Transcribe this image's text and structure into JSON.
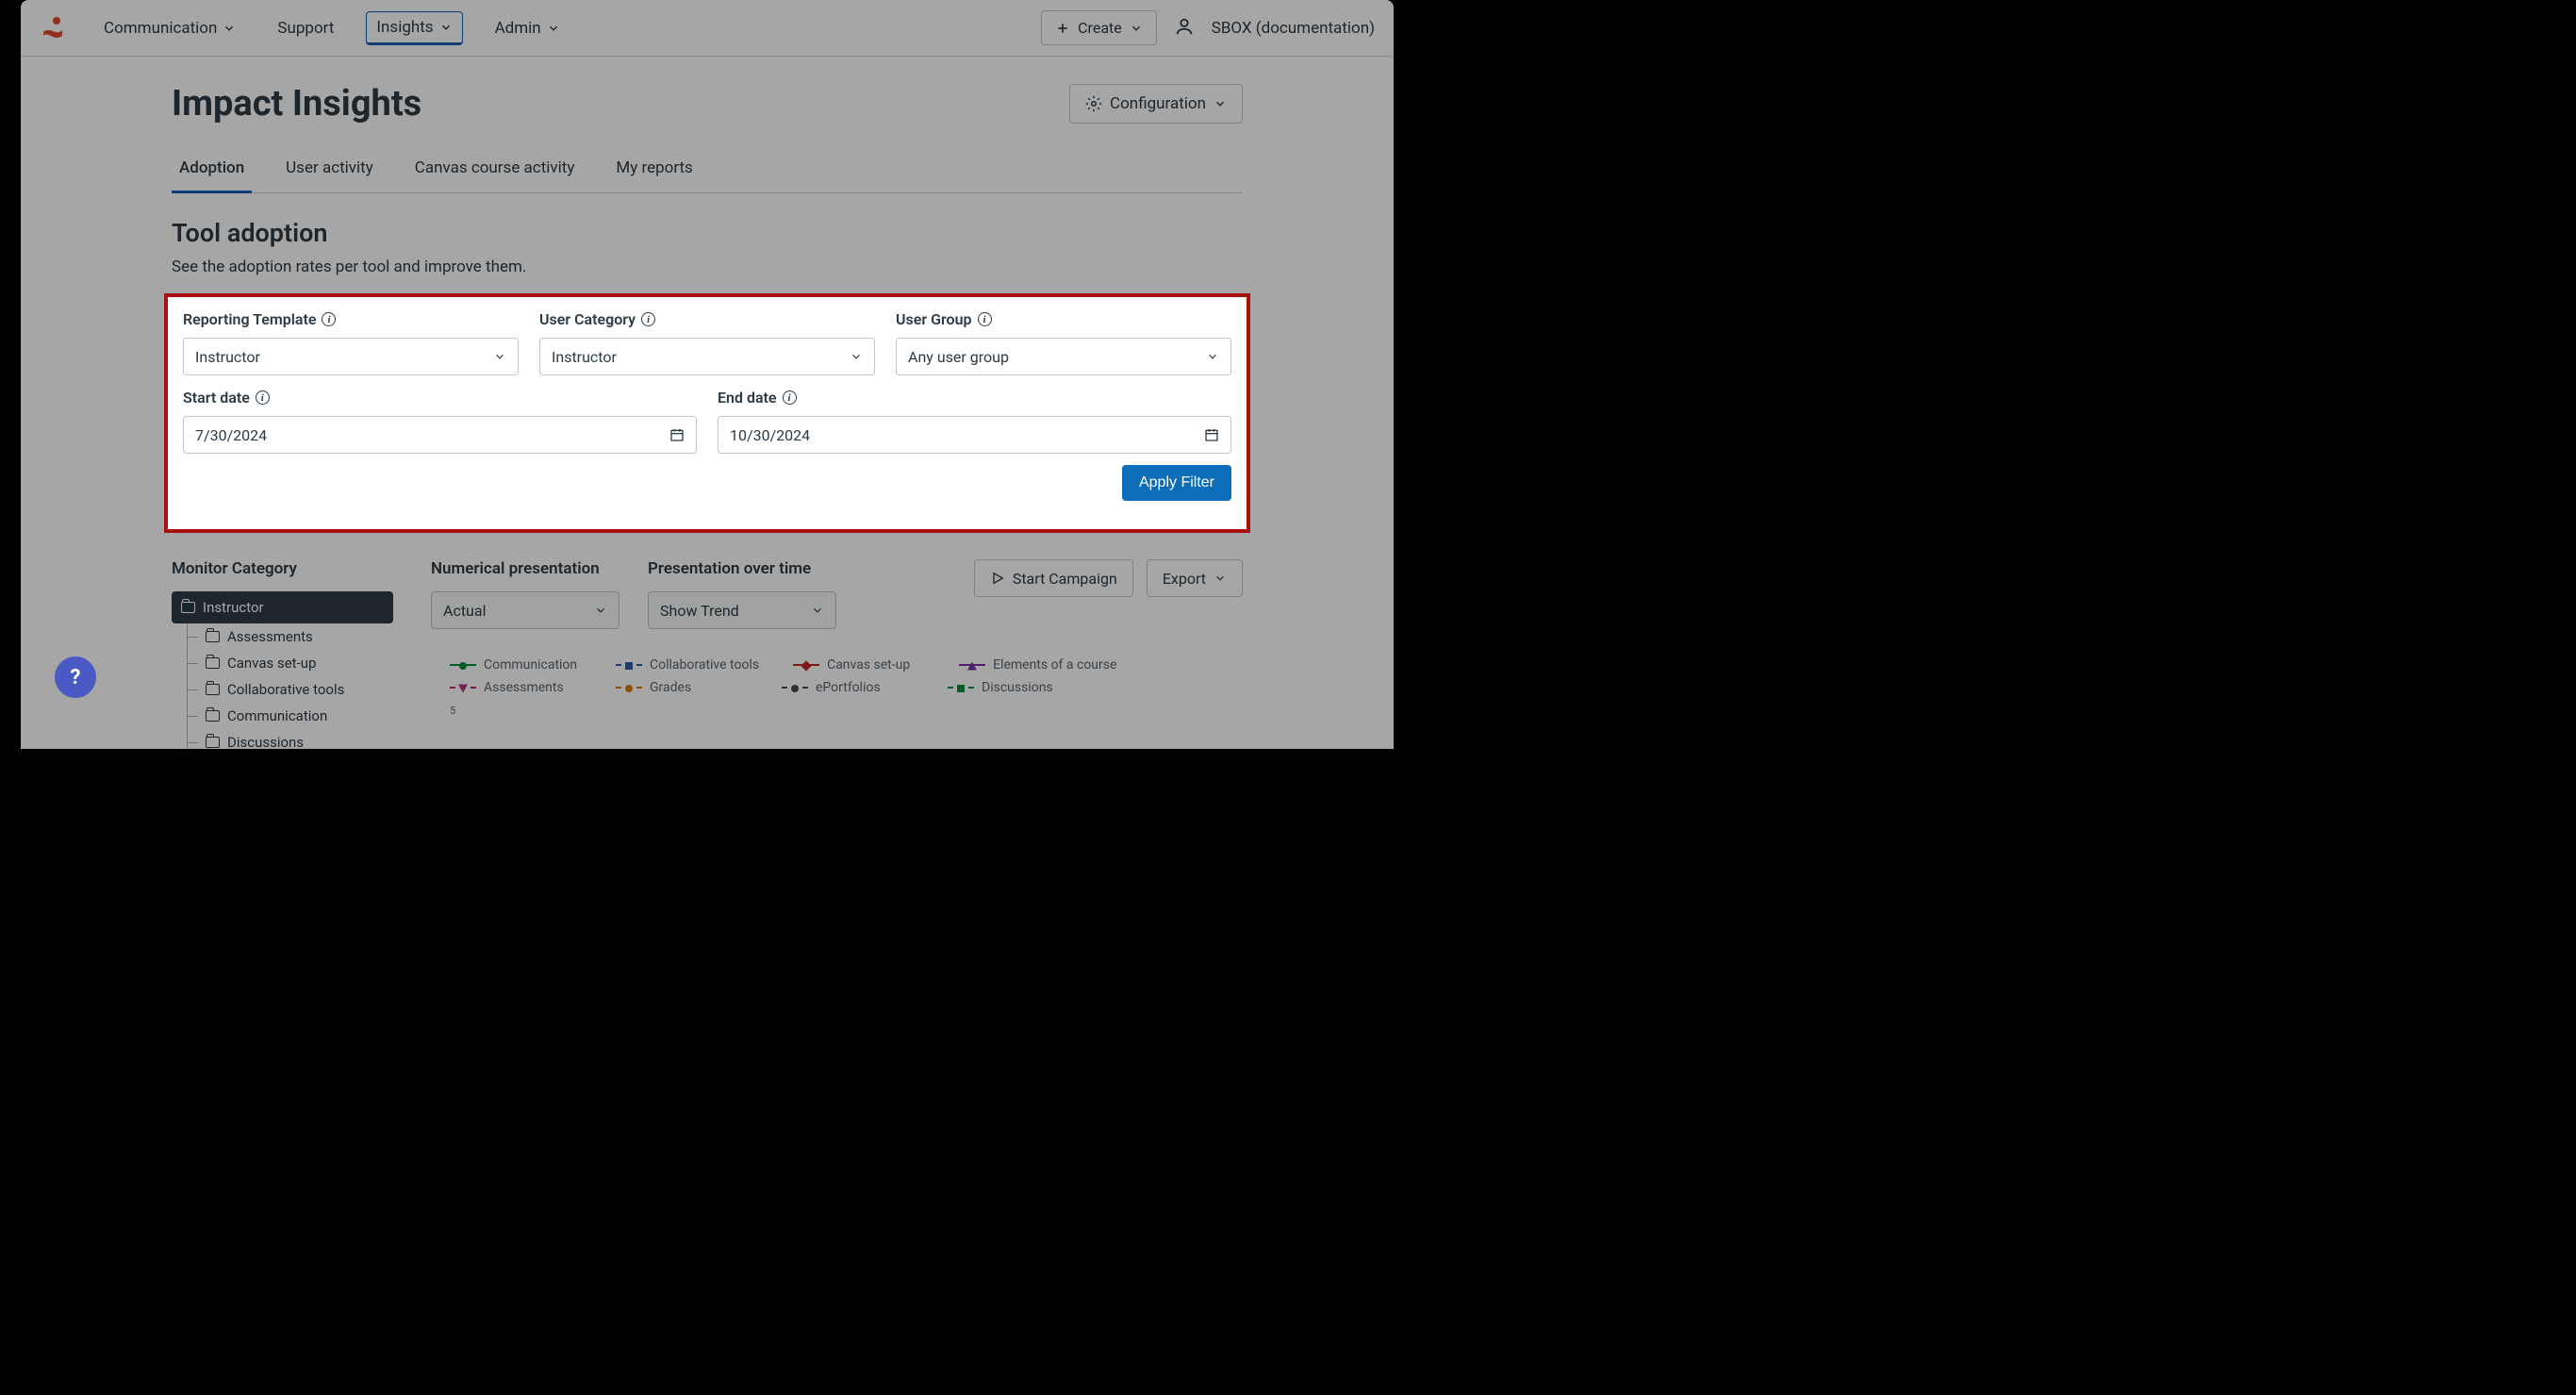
{
  "header": {
    "nav": {
      "communication": "Communication",
      "support": "Support",
      "insights": "Insights",
      "admin": "Admin"
    },
    "create_label": "Create",
    "org_label": "SBOX (documentation)"
  },
  "page": {
    "title": "Impact Insights",
    "configuration_label": "Configuration"
  },
  "tabs": {
    "adoption": "Adoption",
    "user_activity": "User activity",
    "canvas_course_activity": "Canvas course activity",
    "my_reports": "My reports"
  },
  "tool_adoption": {
    "title": "Tool adoption",
    "subtitle": "See the adoption rates per tool and improve them."
  },
  "filters": {
    "reporting_template": {
      "label": "Reporting Template",
      "value": "Instructor"
    },
    "user_category": {
      "label": "User Category",
      "value": "Instructor"
    },
    "user_group": {
      "label": "User Group",
      "value": "Any user group"
    },
    "start_date": {
      "label": "Start date",
      "value": "7/30/2024"
    },
    "end_date": {
      "label": "End date",
      "value": "10/30/2024"
    },
    "apply_label": "Apply Filter"
  },
  "monitor": {
    "label": "Monitor Category",
    "root": "Instructor",
    "items": [
      "Assessments",
      "Canvas set-up",
      "Collaborative tools",
      "Communication",
      "Discussions"
    ]
  },
  "presentation": {
    "numerical_label": "Numerical presentation",
    "numerical_value": "Actual",
    "over_time_label": "Presentation over time",
    "over_time_value": "Show Trend",
    "start_campaign": "Start Campaign",
    "export": "Export"
  },
  "legend": [
    {
      "label": "Communication",
      "color": "#0b8d3f",
      "marker": "circle",
      "style": "solid"
    },
    {
      "label": "Collaborative tools",
      "color": "#2b5ea6",
      "marker": "square",
      "style": "dashed"
    },
    {
      "label": "Canvas set-up",
      "color": "#c4252a",
      "marker": "diamond",
      "style": "solid"
    },
    {
      "label": "Elements of a course",
      "color": "#7c2fa8",
      "marker": "triangle",
      "style": "solid"
    },
    {
      "label": "Assessments",
      "color": "#b83280",
      "marker": "tri-down",
      "style": "dashed"
    },
    {
      "label": "Grades",
      "color": "#d97706",
      "marker": "circle",
      "style": "dashed"
    },
    {
      "label": "ePortfolios",
      "color": "#4a4a4a",
      "marker": "circle",
      "style": "dashed"
    },
    {
      "label": "Discussions",
      "color": "#0b8d3f",
      "marker": "square",
      "style": "dashed"
    }
  ],
  "chart_data": {
    "type": "line",
    "y_ticks": [
      "5"
    ]
  },
  "help": {
    "symbol": "?"
  }
}
